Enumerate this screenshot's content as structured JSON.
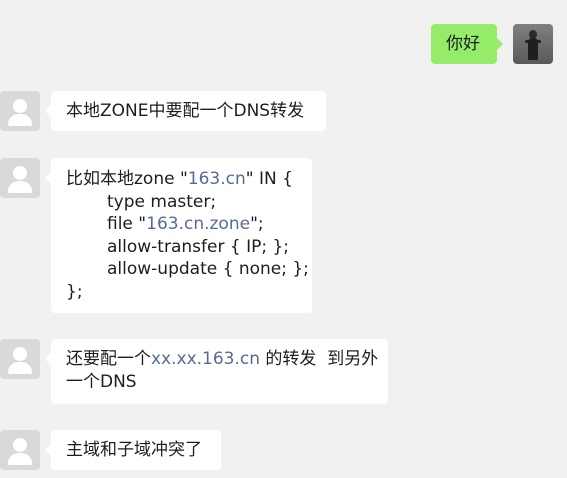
{
  "chat": {
    "sent": {
      "text": "你好"
    },
    "received": [
      {
        "text": "本地ZONE中要配一个DNS转发"
      },
      {
        "line1_a": "比如本地zone \"",
        "line1_link": "163.cn",
        "line1_b": "\" IN {",
        "line2": "type master;",
        "line3_a": "file \"",
        "line3_link": "163.cn.zone",
        "line3_b": "\";",
        "line4": "allow-transfer { IP; };",
        "line5": "allow-update { none; };",
        "line6": "};"
      },
      {
        "text_a": "还要配一个",
        "link": "xx.xx.163.cn",
        "text_b": " 的转发  到另外",
        "line2": "一个DNS"
      },
      {
        "text": "主域和子域冲突了"
      }
    ]
  },
  "colors": {
    "background": "#f1f1f1",
    "sent_bubble": "#95ec69",
    "received_bubble": "#ffffff",
    "link": "#576b95"
  },
  "icons": {
    "user_avatar": "user-photo-avatar",
    "contact_avatar": "default-person-avatar"
  }
}
